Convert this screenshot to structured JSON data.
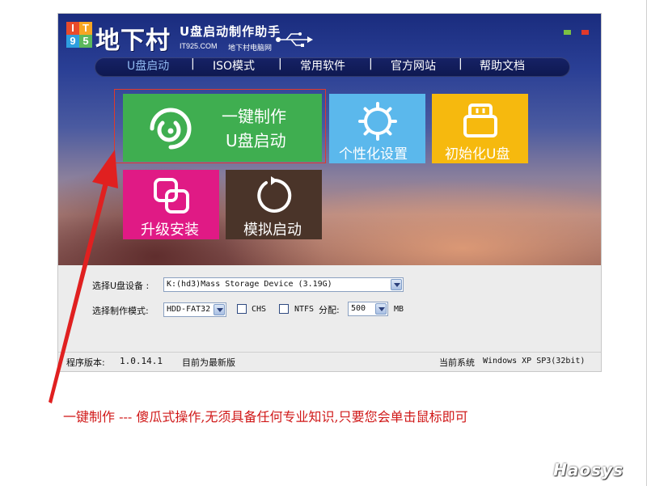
{
  "logo": {
    "grid": [
      "I",
      "T",
      "9",
      "5"
    ],
    "name": "地下村",
    "title": "U盘启动制作助手",
    "site": "IT925.COM",
    "site_name": "地下村电脑网"
  },
  "nav": {
    "items": [
      "U盘启动",
      "ISO模式",
      "常用软件",
      "官方网站",
      "帮助文档"
    ],
    "separator": "|"
  },
  "tiles": {
    "make": [
      "一键制作",
      "U盘启动"
    ],
    "personal": "个性化设置",
    "init": "初始化U盘",
    "upgrade": "升级安装",
    "simulate": "模拟启动"
  },
  "settings": {
    "device_label": "选择U盘设备 :",
    "device_value": "K:(hd3)Mass Storage Device (3.19G)",
    "mode_label": "选择制作模式:",
    "mode_value": "HDD-FAT32",
    "chs_label": "CHS",
    "ntfs_label": "NTFS",
    "alloc_label": "分配:",
    "alloc_value": "500",
    "alloc_unit": "MB"
  },
  "status": {
    "version_label": "程序版本:",
    "version": "1.0.14.1",
    "latest": "目前为最新版",
    "os_label": "当前系统",
    "os": "Windows XP SP3(32bit)"
  },
  "annotation": "一键制作 --- 傻瓜式操作,无须具备任何专业知识,只要您会单击鼠标即可",
  "watermark": "Haosys",
  "colors": {
    "make": "#3fae50",
    "personal": "#5bb8ec",
    "init": "#f6b90e",
    "upgrade": "#e01a85",
    "simulate": "#4a3429",
    "annotation": "#d01818"
  }
}
